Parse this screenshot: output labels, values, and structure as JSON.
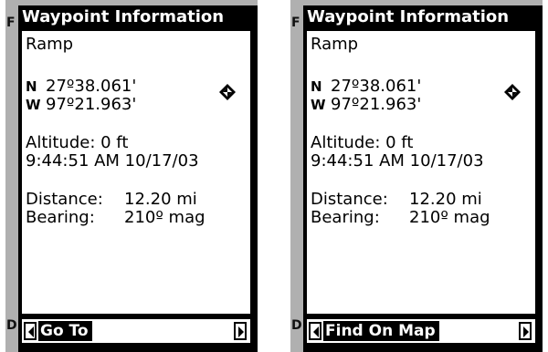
{
  "edge_letters": {
    "top": "F",
    "bottom": "D"
  },
  "screens": [
    {
      "title": "Waypoint Information",
      "name": "Ramp",
      "lat_hemi": "N",
      "lat": "27º38.061'",
      "lon_hemi": "W",
      "lon": "97º21.963'",
      "altitude": "Altitude: 0 ft",
      "datetime": "9:44:51 AM  10/17/03",
      "distance_label": "Distance:",
      "distance_value": "12.20 mi",
      "bearing_label": "Bearing:",
      "bearing_value": "210º mag",
      "action": "Go To"
    },
    {
      "title": "Waypoint Information",
      "name": "Ramp",
      "lat_hemi": "N",
      "lat": "27º38.061'",
      "lon_hemi": "W",
      "lon": "97º21.963'",
      "altitude": "Altitude: 0 ft",
      "datetime": "9:44:51 AM  10/17/03",
      "distance_label": "Distance:",
      "distance_value": "12.20 mi",
      "bearing_label": "Bearing:",
      "bearing_value": "210º mag",
      "action": "Find On Map"
    }
  ]
}
